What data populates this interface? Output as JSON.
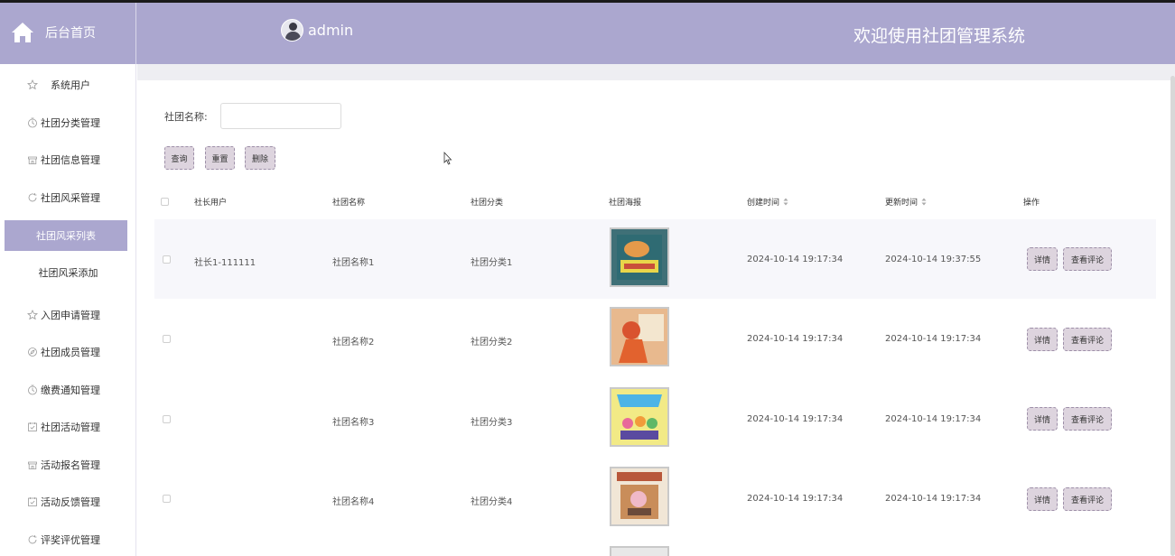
{
  "header": {
    "brand_label": "后台首页",
    "username": "admin",
    "welcome": "欢迎使用社团管理系统",
    "color": "#aba7cf"
  },
  "sidebar": {
    "items": [
      {
        "label": "系统用户",
        "icon": "star-icon"
      },
      {
        "label": "社团分类管理",
        "icon": "timer-icon"
      },
      {
        "label": "社团信息管理",
        "icon": "store-icon"
      },
      {
        "label": "社团风采管理",
        "icon": "refresh-icon"
      },
      {
        "label": "社团风采列表",
        "active": true
      },
      {
        "label": "社团风采添加",
        "sub": true
      },
      {
        "label": "入团申请管理",
        "icon": "star-icon"
      },
      {
        "label": "社团成员管理",
        "icon": "compass-icon"
      },
      {
        "label": "缴费通知管理",
        "icon": "timer-icon"
      },
      {
        "label": "社团活动管理",
        "icon": "calendar-check-icon"
      },
      {
        "label": "活动报名管理",
        "icon": "store-icon"
      },
      {
        "label": "活动反馈管理",
        "icon": "calendar-check-icon"
      },
      {
        "label": "评奖评优管理",
        "icon": "refresh-icon"
      }
    ]
  },
  "search": {
    "label": "社团名称:",
    "value": "",
    "query_label": "查询",
    "reset_label": "重置",
    "delete_label": "删除"
  },
  "table": {
    "headers": [
      "社长用户",
      "社团名称",
      "社团分类",
      "社团海报",
      "创建时间",
      "更新时间",
      "操作"
    ],
    "rows": [
      {
        "leader": "社长1-111111",
        "name": "社团名称1",
        "category": "社团分类1",
        "created": "2024-10-14 19:17:34",
        "updated": "2024-10-14 19:37:55"
      },
      {
        "leader": "",
        "name": "社团名称2",
        "category": "社团分类2",
        "created": "2024-10-14 19:17:34",
        "updated": "2024-10-14 19:17:34"
      },
      {
        "leader": "",
        "name": "社团名称3",
        "category": "社团分类3",
        "created": "2024-10-14 19:17:34",
        "updated": "2024-10-14 19:17:34"
      },
      {
        "leader": "",
        "name": "社团名称4",
        "category": "社团分类4",
        "created": "2024-10-14 19:17:34",
        "updated": "2024-10-14 19:17:34"
      }
    ],
    "detail_label": "详情",
    "comments_label": "查看评论"
  }
}
